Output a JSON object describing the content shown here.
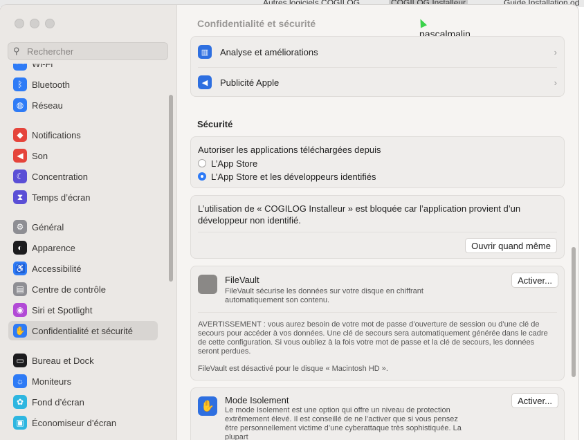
{
  "background": {
    "tabs": [
      "Autres logiciels COGILOG",
      "COGILOG Installeur",
      "Guide Installation od"
    ]
  },
  "window": {
    "title": "Confidentialité et sécurité",
    "username": "pascalmalin..."
  },
  "sidebar": {
    "search_placeholder": "Rechercher",
    "items": [
      {
        "label": "Wi-Fi",
        "color": "#2e7bf6",
        "glyph": "◠"
      },
      {
        "label": "Bluetooth",
        "color": "#2e7bf6",
        "glyph": "ᛒ"
      },
      {
        "label": "Réseau",
        "color": "#2e7bf6",
        "glyph": "◍"
      },
      {
        "label": "Notifications",
        "color": "#e5443b",
        "glyph": "◆"
      },
      {
        "label": "Son",
        "color": "#e5443b",
        "glyph": "◀"
      },
      {
        "label": "Concentration",
        "color": "#5b4fd6",
        "glyph": "☾"
      },
      {
        "label": "Temps d’écran",
        "color": "#5b4fd6",
        "glyph": "⧗"
      },
      {
        "label": "Général",
        "color": "#8e8e93",
        "glyph": "⚙"
      },
      {
        "label": "Apparence",
        "color": "#1c1c1e",
        "glyph": "◐"
      },
      {
        "label": "Accessibilité",
        "color": "#2e7bf6",
        "glyph": "♿"
      },
      {
        "label": "Centre de contrôle",
        "color": "#8e8e93",
        "glyph": "▤"
      },
      {
        "label": "Siri et Spotlight",
        "color": "#b24ad6",
        "glyph": "◉"
      },
      {
        "label": "Confidentialité et sécurité",
        "color": "#2e7bf6",
        "glyph": "✋"
      },
      {
        "label": "Bureau et Dock",
        "color": "#1c1c1e",
        "glyph": "▭"
      },
      {
        "label": "Moniteurs",
        "color": "#2e7bf6",
        "glyph": "☼"
      },
      {
        "label": "Fond d’écran",
        "color": "#2eb6e0",
        "glyph": "✿"
      },
      {
        "label": "Économiseur d’écran",
        "color": "#2eb6e0",
        "glyph": "▣"
      }
    ]
  },
  "main": {
    "rows": [
      {
        "label": "Analyse et améliorations",
        "glyph": "▥"
      },
      {
        "label": "Publicité Apple",
        "glyph": "◀"
      }
    ],
    "security_title": "Sécurité",
    "allow_label": "Autoriser les applications téléchargées depuis",
    "radio1": "L’App Store",
    "radio2": "L’App Store et les développeurs identifiés",
    "blocked_text": "L’utilisation de « COGILOG Installeur » est bloquée car l’application provient d’un développeur non identifié.",
    "open_anyway": "Ouvrir quand même",
    "filevault": {
      "title": "FileVault",
      "desc": "FileVault sécurise les données sur votre disque en chiffrant automatiquement son contenu.",
      "button": "Activer...",
      "warning": "AVERTISSEMENT : vous aurez besoin de votre mot de passe d’ouverture de session ou d’une clé de secours pour accéder à vos données. Une clé de secours sera automatiquement générée dans le cadre de cette configuration. Si vous oubliez à la fois votre mot de passe et la clé de secours, les données seront perdues.",
      "status": "FileVault est désactivé pour le disque « Macintosh HD »."
    },
    "lockdown": {
      "title": "Mode Isolement",
      "desc": "Le mode Isolement est une option qui offre un niveau de protection extrêmement élevé. Il est conseillé de ne l’activer que si vous pensez être personnellement victime d’une cyberattaque très sophistiquée. La plupart",
      "button": "Activer..."
    }
  }
}
